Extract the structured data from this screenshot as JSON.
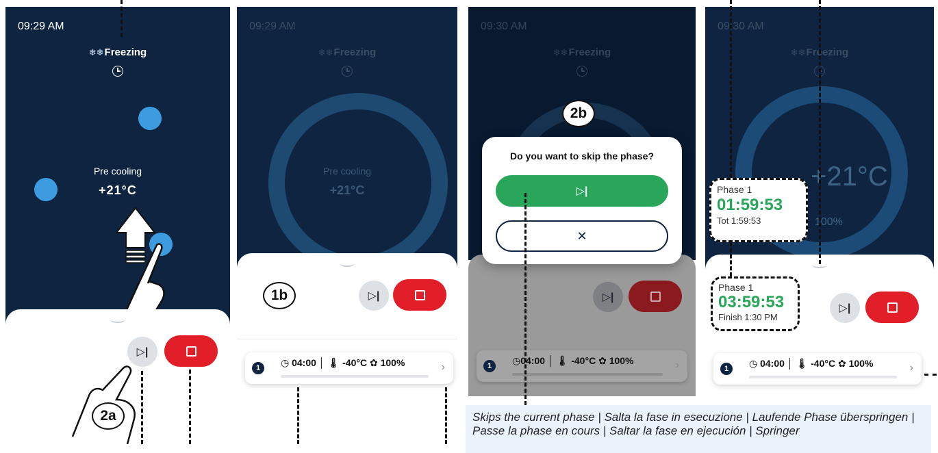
{
  "screens": {
    "s1": {
      "time": "09:29 AM",
      "mode": "Freezing",
      "status": "Pre cooling",
      "temp": "+21°C"
    },
    "s2": {
      "time": "09:29 AM",
      "mode": "Freezing",
      "status": "Pre cooling",
      "temp": "+21°C"
    },
    "s3": {
      "time": "09:30 AM",
      "mode": "Freezing"
    },
    "s4": {
      "time": "09:30 AM",
      "mode": "Freezing",
      "temp": "+21°C",
      "fan_partial": "100%"
    }
  },
  "step_labels": {
    "a": "2a",
    "b": "1b",
    "c": "2b"
  },
  "controls": {
    "skip_symbol": "▷|",
    "close_symbol": "✕",
    "chevron": "›"
  },
  "phase_card": {
    "number": "1",
    "duration": "04:00",
    "temperature": "-40°C",
    "fan": "100%"
  },
  "dialog": {
    "question": "Do you want to skip the phase?"
  },
  "callout_popup": {
    "phase": "Phase 1",
    "timer": "01:59:53",
    "total": "Tot 1:59:53"
  },
  "callout_inline": {
    "phase": "Phase 1",
    "timer": "03:59:53",
    "finish": "Finish 1:30 PM"
  },
  "caption": "Skips the current phase | Salta la fase in esecuzione | Laufende Phase überspringen | Passe la phase en cours | Saltar la fase en ejecución | Springer",
  "colors": {
    "screen_bg": "#0e2440",
    "accent_blue": "#3d9ce0",
    "stop_red": "#e21e28",
    "confirm_green": "#2aa65a",
    "timer_green": "#2aa65a"
  }
}
